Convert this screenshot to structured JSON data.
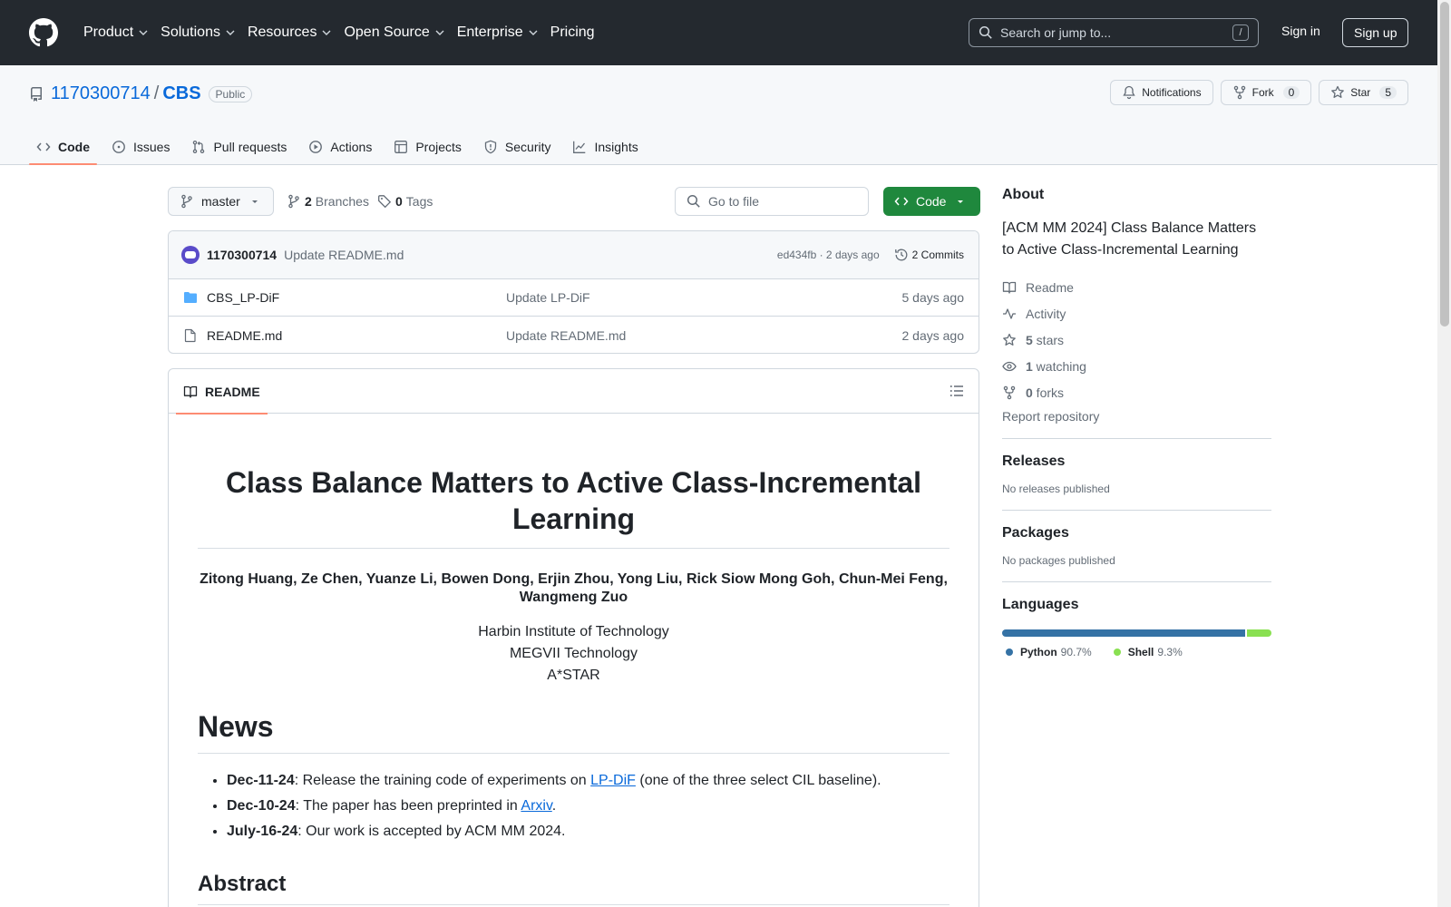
{
  "colors": {
    "header_bg": "#24292f",
    "link": "#0969da",
    "primary_button": "#1f883d",
    "active_tab_underline": "#fd8c73"
  },
  "header": {
    "nav": [
      {
        "label": "Product",
        "dropdown": true
      },
      {
        "label": "Solutions",
        "dropdown": true
      },
      {
        "label": "Resources",
        "dropdown": true
      },
      {
        "label": "Open Source",
        "dropdown": true
      },
      {
        "label": "Enterprise",
        "dropdown": true
      },
      {
        "label": "Pricing",
        "dropdown": false
      }
    ],
    "search_placeholder": "Search or jump to...",
    "search_shortcut": "/",
    "sign_in": "Sign in",
    "sign_up": "Sign up"
  },
  "repo": {
    "owner": "1170300714",
    "separator": "/",
    "name": "CBS",
    "visibility": "Public",
    "notifications_label": "Notifications",
    "fork_label": "Fork",
    "fork_count": "0",
    "star_label": "Star",
    "star_count": "5",
    "tabs": [
      {
        "label": "Code",
        "icon": "code-icon",
        "active": true
      },
      {
        "label": "Issues",
        "icon": "issue-icon",
        "active": false
      },
      {
        "label": "Pull requests",
        "icon": "pull-request-icon",
        "active": false
      },
      {
        "label": "Actions",
        "icon": "play-icon",
        "active": false
      },
      {
        "label": "Projects",
        "icon": "table-icon",
        "active": false
      },
      {
        "label": "Security",
        "icon": "shield-icon",
        "active": false
      },
      {
        "label": "Insights",
        "icon": "graph-icon",
        "active": false
      }
    ]
  },
  "code_bar": {
    "branch": "master",
    "branches_count": "2",
    "branches_label": "Branches",
    "tags_count": "0",
    "tags_label": "Tags",
    "go_to_file": "Go to file",
    "code_button": "Code"
  },
  "commit": {
    "author": "1170300714",
    "message": "Update README.md",
    "hash_time": "ed434fb · 2 days ago",
    "commits_label": "2 Commits"
  },
  "files": [
    {
      "type": "folder",
      "name": "CBS_LP-DiF",
      "message": "Update LP-DiF",
      "date": "5 days ago"
    },
    {
      "type": "file",
      "name": "README.md",
      "message": "Update README.md",
      "date": "2 days ago"
    }
  ],
  "readme": {
    "tab_label": "README",
    "title": "Class Balance Matters to Active Class-Incremental Learning",
    "authors": "Zitong Huang, Ze Chen, Yuanze Li, Bowen Dong, Erjin Zhou, Yong Liu, Rick Siow Mong Goh, Chun-Mei Feng, Wangmeng Zuo",
    "affiliations": [
      "Harbin Institute of Technology",
      "MEGVII Technology",
      "A*STAR"
    ],
    "news_heading": "News",
    "news": [
      {
        "date": "Dec-11-24",
        "pre": ": Release the training code of experiments on ",
        "link": "LP-DiF",
        "post": " (one of the three select CIL baseline)."
      },
      {
        "date": "Dec-10-24",
        "pre": ": The paper has been preprinted in ",
        "link": "Arxiv",
        "post": "."
      },
      {
        "date": "July-16-24",
        "pre": ": Our work is accepted by ACM MM 2024.",
        "link": "",
        "post": ""
      }
    ],
    "abstract_heading": "Abstract"
  },
  "sidebar": {
    "about_heading": "About",
    "description": "[ACM MM 2024] Class Balance Matters to Active Class-Incremental Learning",
    "items": [
      {
        "icon": "book-icon",
        "bold": "",
        "label": "Readme"
      },
      {
        "icon": "pulse-icon",
        "bold": "",
        "label": "Activity"
      },
      {
        "icon": "star-icon",
        "bold": "5",
        "label": " stars"
      },
      {
        "icon": "eye-icon",
        "bold": "1",
        "label": " watching"
      },
      {
        "icon": "fork-icon",
        "bold": "0",
        "label": " forks"
      }
    ],
    "report": "Report repository",
    "releases_heading": "Releases",
    "releases_text": "No releases published",
    "packages_heading": "Packages",
    "packages_text": "No packages published",
    "languages_heading": "Languages",
    "languages": [
      {
        "name": "Python",
        "percent": "90.7%",
        "value": 90.7,
        "color": "#3572A5"
      },
      {
        "name": "Shell",
        "percent": "9.3%",
        "value": 9.3,
        "color": "#89e051"
      }
    ]
  }
}
